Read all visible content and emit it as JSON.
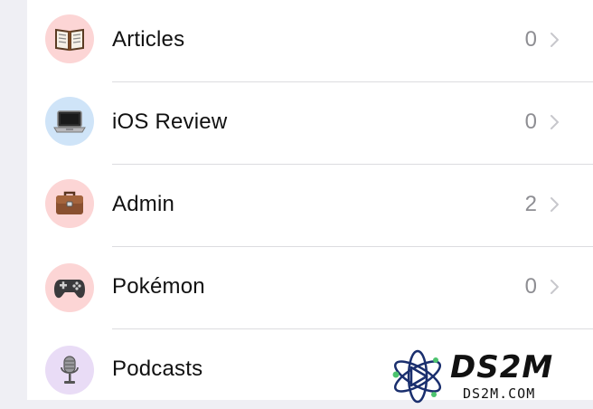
{
  "list": {
    "items": [
      {
        "label": "Articles",
        "count": "0",
        "icon": "open-book-icon",
        "icon_bg": "#fcd5d5"
      },
      {
        "label": "iOS Review",
        "count": "0",
        "icon": "laptop-icon",
        "icon_bg": "#cfe4f8"
      },
      {
        "label": "Admin",
        "count": "2",
        "icon": "briefcase-icon",
        "icon_bg": "#fcd5d5"
      },
      {
        "label": "Pokémon",
        "count": "0",
        "icon": "game-controller-icon",
        "icon_bg": "#fcd5d5"
      },
      {
        "label": "Podcasts",
        "count": "",
        "icon": "microphone-icon",
        "icon_bg": "#e9dcf6"
      }
    ]
  },
  "watermark": {
    "title": "DS2M",
    "url": "DS2M.COM"
  },
  "colors": {
    "chevron": "#c7c7cc",
    "count_text": "#8e8e93",
    "label_text": "#111111",
    "divider": "#dcdce0",
    "gutter": "#efeff4"
  }
}
